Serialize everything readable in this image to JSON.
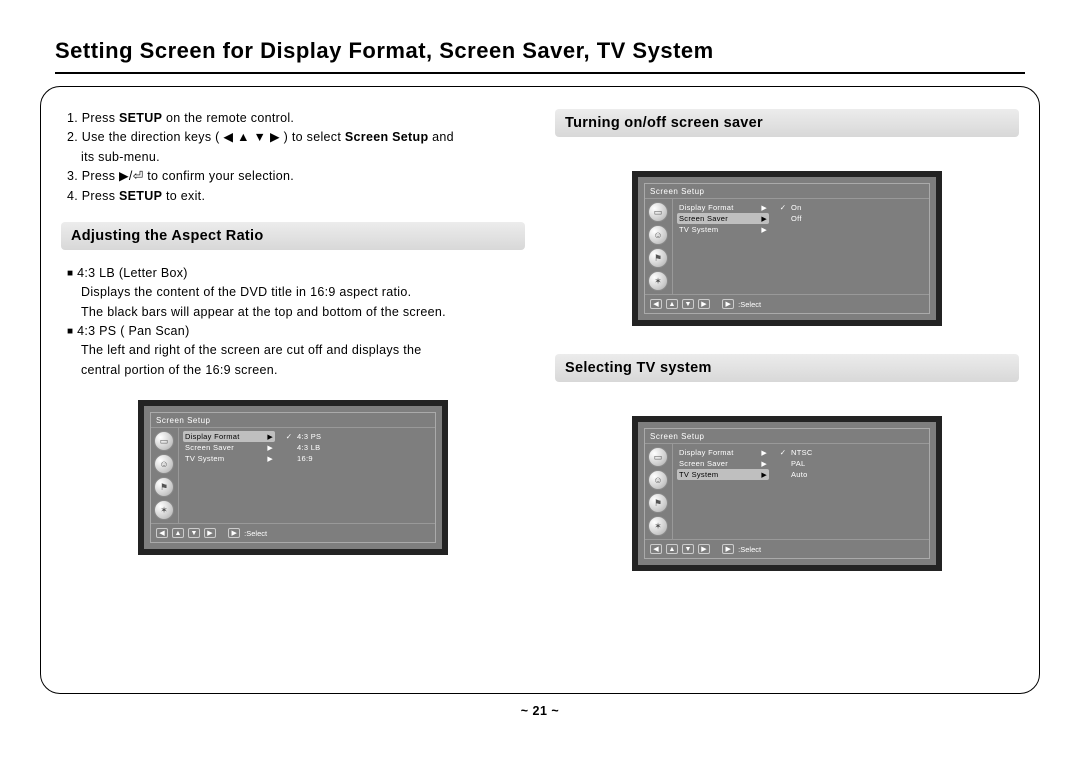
{
  "title": "Setting Screen for Display Format, Screen Saver, TV System",
  "page_number": "~ 21 ~",
  "instructions": {
    "i1a": "1. Press ",
    "i1b": "SETUP",
    "i1c": " on the remote control.",
    "i2a": "2. Use the direction keys ( ◀ ▲ ▼ ▶ ) to select ",
    "i2b": "Screen Setup",
    "i2c": " and",
    "i2d": "its sub-menu.",
    "i3": "3. Press  ▶/⏎  to confirm your selection.",
    "i4a": "4. Press ",
    "i4b": "SETUP",
    "i4c": " to exit."
  },
  "section_aspect": "Adjusting the Aspect Ratio",
  "aspect": {
    "l1": "4:3 LB (Letter Box)",
    "l2": "Displays the content of the DVD title in 16:9 aspect ratio.",
    "l3": "The black bars will appear at the top and bottom of the screen.",
    "l4": "4:3 PS ( Pan Scan)",
    "l5": "The left and right of the screen are cut off and displays the",
    "l6": "central portion of the 16:9 screen."
  },
  "section_saver": "Turning on/off screen saver",
  "section_tv": "Selecting TV system",
  "osd_common": {
    "title": "Screen Setup",
    "menu_display": "Display Format",
    "menu_saver": "Screen Saver",
    "menu_tv": "TV System",
    "select": ":Select"
  },
  "osd_aspect_opts": {
    "o1": "4:3 PS",
    "o2": "4:3 LB",
    "o3": "16:9"
  },
  "osd_saver_opts": {
    "o1": "On",
    "o2": "Off"
  },
  "osd_tv_opts": {
    "o1": "NTSC",
    "o2": "PAL",
    "o3": "Auto"
  }
}
